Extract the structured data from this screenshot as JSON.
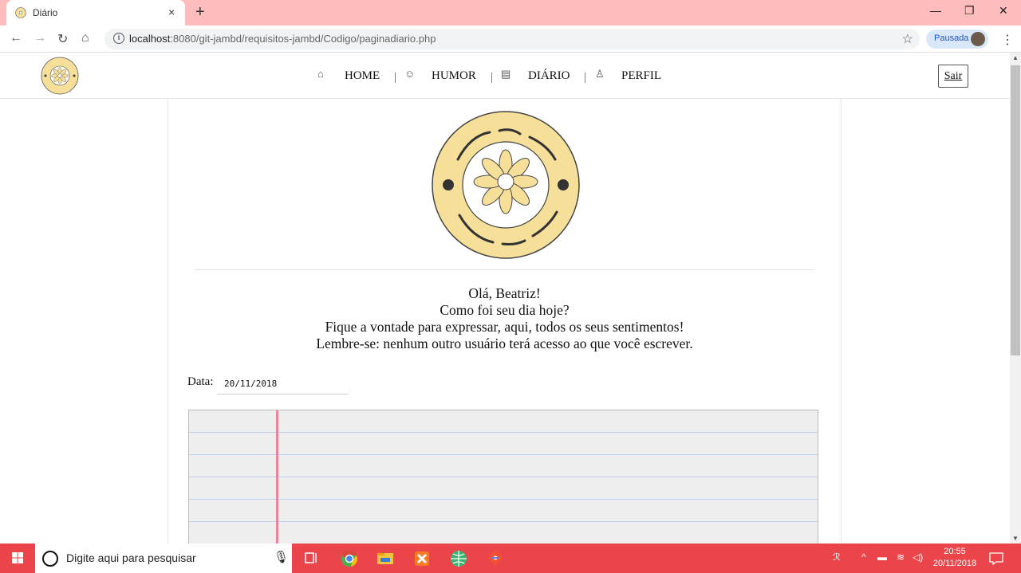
{
  "browser": {
    "tab_title": "Diário",
    "tab_close": "×",
    "new_tab": "+",
    "url_host": "localhost",
    "url_path": ":8080/git-jambd/requisitos-jambd/Codigo/paginadiario.php",
    "profile_label": "Pausada",
    "win_minimize": "—",
    "win_restore": "❐",
    "win_close": "✕"
  },
  "site": {
    "brand_color": "#f6df98",
    "menu": [
      {
        "icon": "home-icon",
        "label": "HOME"
      },
      {
        "icon": "humor-icon",
        "label": "HUMOR"
      },
      {
        "icon": "diary-icon",
        "label": "DIÁRIO"
      },
      {
        "icon": "profile-icon",
        "label": "PERFIL"
      }
    ],
    "separator": "|",
    "logout_label": "Sair"
  },
  "content": {
    "greeting_lines": [
      "Olá, Beatriz!",
      "Como foi seu dia hoje?",
      "Fique a vontade para expressar, aqui, todos os seus sentimentos!",
      "Lembre-se: nenhum outro usuário terá acesso ao que você escrever."
    ],
    "date_label": "Data:",
    "date_value": "20/11/2018"
  },
  "taskbar": {
    "search_placeholder": "Digite aqui para pesquisar",
    "time": "20:55",
    "date": "20/11/2018",
    "accent_color": "#e9454b"
  }
}
